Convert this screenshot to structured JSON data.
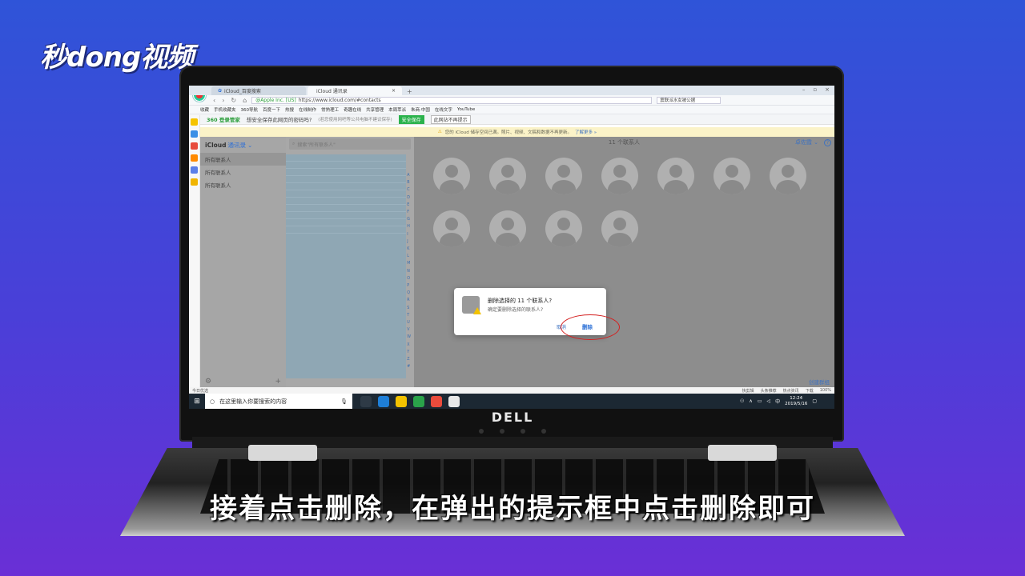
{
  "logo": "秒dong视频",
  "subtitle": "接着点击删除，在弹出的提示框中点击删除即可",
  "laptop_brand": "DELL",
  "browser": {
    "tabs": [
      {
        "label": "iCloud_百度搜索",
        "icon": "paw-icon"
      },
      {
        "label": "iCloud 通讯录",
        "icon": "apple-icon"
      }
    ],
    "url_cert": "@Apple Inc. [US]",
    "url": "https://www.icloud.com/#contacts",
    "search_placeholder": "震联派水女被公据",
    "bookmarks": [
      "收藏",
      "手机收藏夹",
      "360导航",
      "百度一下",
      "热搜",
      "在线制作",
      "常熟理工",
      "奇趣在线",
      "共享管理",
      "本周萃派",
      "朱商·中国",
      "在线文字",
      "YouTube"
    ],
    "pw_brand": "360 登录管家",
    "pw_question": "想安全保存此网页的密码吗?",
    "pw_hint": "(若您使用网吧等公共电脑不建议保存)",
    "pw_save": "安全保存",
    "pw_never": "此网站不再提示"
  },
  "banner": {
    "text": "您的 iCloud 储存空间已满。照片、视频、文稿和数据不再更新。",
    "link": "了解更多 »"
  },
  "icloud": {
    "brand": "iCloud",
    "app": "通讯录",
    "groups": [
      "所有联系人",
      "所有联系人",
      "所有联系人"
    ],
    "search_placeholder": "搜索\"所有联系人\"",
    "contact_count": "11 个联系人",
    "sort": "卓佐霞",
    "alpha_index": [
      "A",
      "B",
      "C",
      "D",
      "E",
      "F",
      "G",
      "H",
      "I",
      "J",
      "K",
      "L",
      "M",
      "N",
      "O",
      "P",
      "Q",
      "R",
      "S",
      "T",
      "U",
      "V",
      "W",
      "X",
      "Y",
      "Z",
      "#"
    ],
    "create_group": "创建群组",
    "avatar_count": 11
  },
  "dialog": {
    "title": "删除选择的 11 个联系人?",
    "message": "确定要删除选择的联系人?",
    "cancel": "取消",
    "delete": "删除"
  },
  "statusbar": {
    "left": "今日优选",
    "items": [
      "快剪辑",
      "头条推荐",
      "热点资讯",
      "下载",
      "100%"
    ]
  },
  "taskbar": {
    "search_placeholder": "在这里输入你要搜索的内容",
    "time": "12:24",
    "date": "2019/5/16",
    "ime": "中"
  }
}
